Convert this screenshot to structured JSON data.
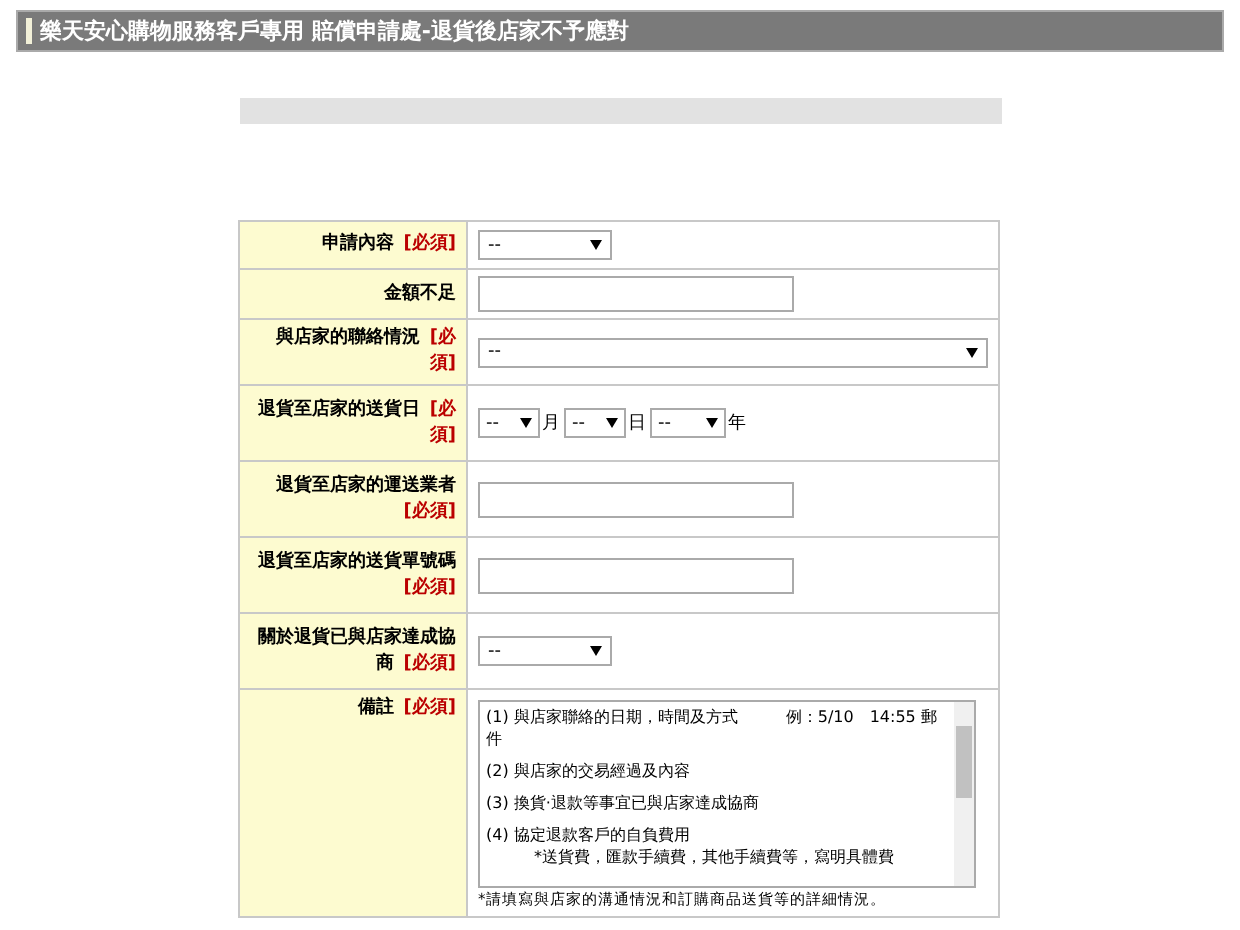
{
  "header": {
    "title": "樂天安心購物服務客戶專用 賠償申請處-退貨後店家不予應對"
  },
  "form": {
    "rows": [
      {
        "label": "申請內容",
        "required": "[必須]",
        "kind": "select",
        "value": "--",
        "wide": false
      },
      {
        "label": "金額不足",
        "kind": "input"
      },
      {
        "label": "與店家的聯絡情況",
        "required": "[必須]",
        "kind": "select",
        "value": "--",
        "wide": true
      },
      {
        "label": "退貨至店家的送貨日",
        "required": "[必須]",
        "kind": "date",
        "fields": [
          {
            "value": "--",
            "unit": "月"
          },
          {
            "value": "--",
            "unit": "日"
          },
          {
            "value": "--",
            "unit": "年"
          }
        ]
      },
      {
        "label": "退貨至店家的運送業者",
        "required": "[必須]",
        "kind": "input"
      },
      {
        "label": "退貨至店家的送貨單號碼",
        "required": "[必須]",
        "kind": "input"
      },
      {
        "label": "關於退貨已與店家達成協商",
        "required": "[必須]",
        "kind": "select",
        "value": "--",
        "wide": false
      },
      {
        "label": "備註",
        "required": "[必須]",
        "kind": "textarea",
        "paragraphs": [
          "(1) 與店家聯絡的日期，時間及方式　　　例：5/10　14:55 郵件",
          "(2) 與店家的交易經過及內容",
          "(3) 換貨·退款等事宜已與店家達成協商",
          "(4) 協定退款客戶的自負費用\n　　　*送貨費，匯款手續費，其他手續費等，寫明具體費"
        ],
        "note": "*請填寫與店家的溝通情況和訂購商品送貨等的詳細情況。"
      }
    ]
  }
}
